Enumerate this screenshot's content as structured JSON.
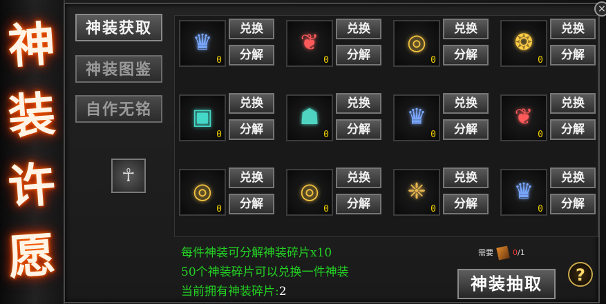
{
  "side_title": [
    "神",
    "装",
    "许",
    "愿"
  ],
  "tabs": [
    {
      "label": "神装获取",
      "active": true
    },
    {
      "label": "神装图鉴",
      "active": false
    },
    {
      "label": "自作无铭",
      "active": false
    }
  ],
  "badge_icon": "helmet-emblem-icon",
  "items": [
    {
      "icon": "helmet-icon",
      "qty": "0",
      "exchange": "兑换",
      "decompose": "分解"
    },
    {
      "icon": "necklace-icon",
      "qty": "0",
      "exchange": "兑换",
      "decompose": "分解"
    },
    {
      "icon": "ring-icon",
      "qty": "0",
      "exchange": "兑换",
      "decompose": "分解"
    },
    {
      "icon": "bracelet-icon",
      "qty": "0",
      "exchange": "兑换",
      "decompose": "分解"
    },
    {
      "icon": "bracer-icon",
      "qty": "0",
      "exchange": "兑换",
      "decompose": "分解"
    },
    {
      "icon": "boots-icon",
      "qty": "0",
      "exchange": "兑换",
      "decompose": "分解"
    },
    {
      "icon": "helmet-icon",
      "qty": "0",
      "exchange": "兑换",
      "decompose": "分解"
    },
    {
      "icon": "necklace-icon",
      "qty": "0",
      "exchange": "兑换",
      "decompose": "分解"
    },
    {
      "icon": "ring-icon",
      "qty": "0",
      "exchange": "兑换",
      "decompose": "分解"
    },
    {
      "icon": "ring-icon",
      "qty": "0",
      "exchange": "兑换",
      "decompose": "分解"
    },
    {
      "icon": "belt-icon",
      "qty": "0",
      "exchange": "兑换",
      "decompose": "分解"
    },
    {
      "icon": "helmet-icon",
      "qty": "0",
      "exchange": "兑换",
      "decompose": "分解"
    }
  ],
  "info": {
    "line1": "每件神装可分解神装碎片x10",
    "line2": "50个神装碎片可以兑换一件神装",
    "line3_label": "当前拥有神装碎片:",
    "line3_count": "2"
  },
  "need": {
    "label": "需要",
    "have": "0",
    "total": "/1"
  },
  "draw_button": "神装抽取",
  "help_button": "?",
  "close_button": "×",
  "colors": {
    "accent_green": "#23d323",
    "qty_yellow": "#f2d000",
    "need_red": "#ff3a3a"
  }
}
